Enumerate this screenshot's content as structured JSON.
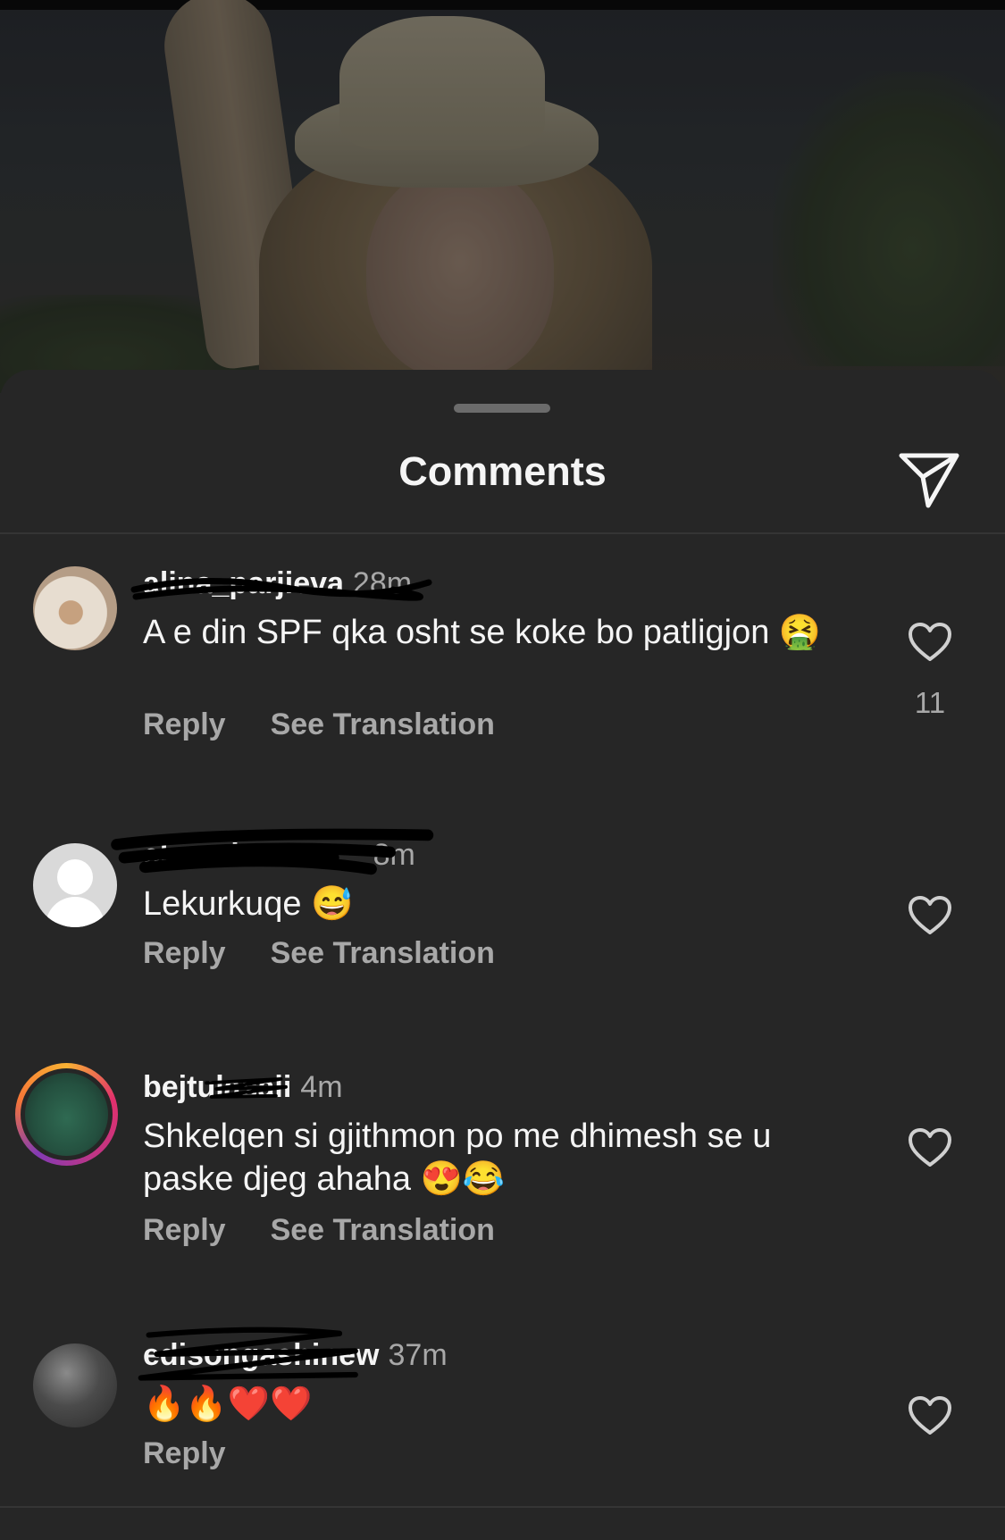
{
  "sheet": {
    "title": "Comments"
  },
  "comments": [
    {
      "username": "alina_parjieva",
      "time": "28m",
      "text": "A e din SPF qka osht se koke bo patligjon 🤮",
      "reply": "Reply",
      "translate": "See Translation",
      "likes": "11"
    },
    {
      "username": "closed4everr__",
      "time": "8m",
      "text": "Lekurkuqe 😅",
      "reply": "Reply",
      "translate": "See Translation"
    },
    {
      "username": "bejtulasali",
      "time": "4m",
      "text": "Shkelqen  si gjithmon  po me dhimesh se u paske djeg ahaha 😍😂",
      "reply": "Reply",
      "translate": "See Translation"
    },
    {
      "username": "edisongashinew",
      "time": "37m",
      "text": "🔥🔥❤️❤️",
      "reply": "Reply"
    }
  ],
  "icons": {
    "share": "paper-plane-icon",
    "like": "heart-outline-icon"
  },
  "colors": {
    "background": "#262626",
    "muted": "#a8a8a8",
    "story_ring": "#e1306c"
  }
}
